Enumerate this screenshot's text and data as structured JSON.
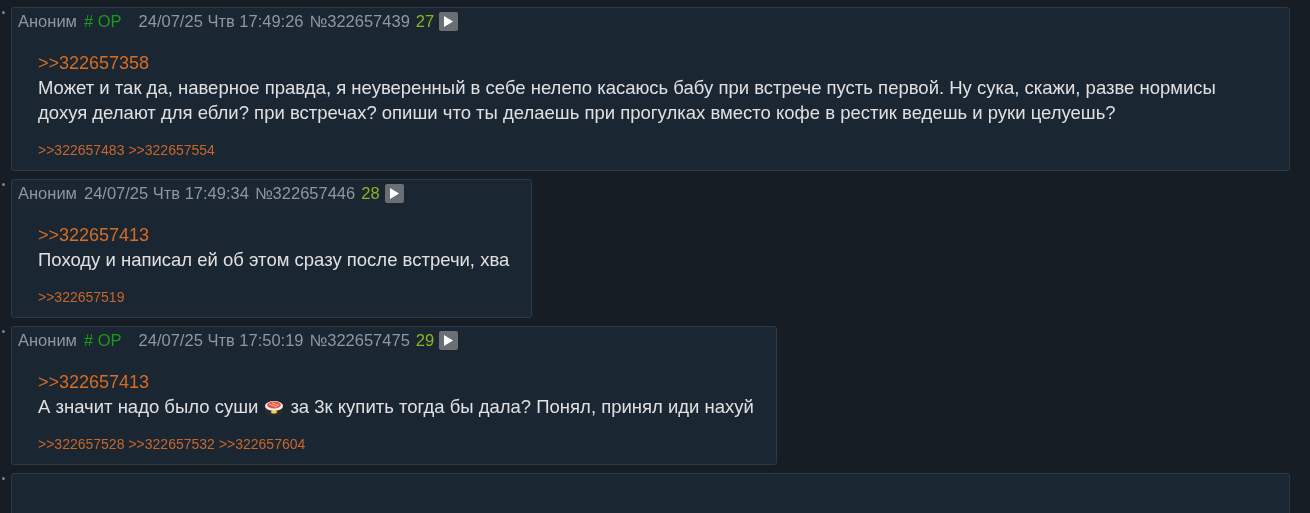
{
  "posts": [
    {
      "name": "Аноним",
      "tag": "# OP",
      "date": "24/07/25 Чтв 17:49:26",
      "number": "№322657439",
      "count": "27",
      "reply_to": ">>322657358",
      "body": [
        {
          "kind": "text",
          "text": "Может и так да, наверное правда, я неуверенный в себе нелепо касаюсь бабу при встрече пусть первой. Ну сука, скажи, разве нормисы дохуя делают для ебли? при встречах? опиши что ты делаешь при прогулках вместо кофе в рестик ведешь и руки целуешь?"
        }
      ],
      "backlinks": [
        ">>322657483",
        ">>322657554"
      ]
    },
    {
      "name": "Аноним",
      "date": "24/07/25 Чтв 17:49:34",
      "number": "№322657446",
      "count": "28",
      "reply_to": ">>322657413",
      "body": [
        {
          "kind": "text",
          "text": "Походу и написал ей об этом сразу после встречи, хва"
        }
      ],
      "backlinks": [
        ">>322657519"
      ]
    },
    {
      "name": "Аноним",
      "tag": "# OP",
      "date": "24/07/25 Чтв 17:50:19",
      "number": "№322657475",
      "count": "29",
      "reply_to": ">>322657413",
      "body": [
        {
          "kind": "text",
          "text": "А значит надо было суши"
        },
        {
          "kind": "emoji"
        },
        {
          "kind": "text",
          "text": "за 3к купить тогда бы дала? Понял, принял иди нахуй"
        }
      ],
      "backlinks": [
        ">>322657528",
        ">>322657532",
        ">>322657604"
      ]
    }
  ],
  "more_posts_below": true
}
